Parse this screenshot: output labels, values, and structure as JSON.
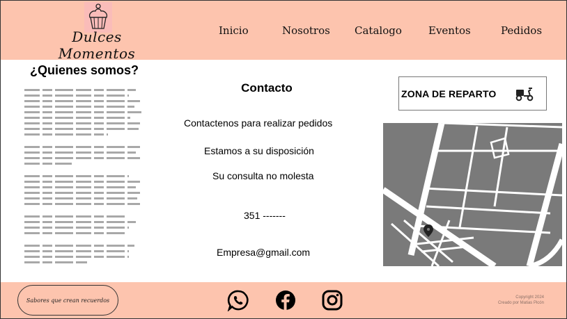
{
  "header": {
    "logo_text": "Dulces Momentos",
    "nav": [
      {
        "label": "Inicio"
      },
      {
        "label": "Nosotros"
      },
      {
        "label": "Catalogo"
      },
      {
        "label": "Eventos"
      },
      {
        "label": "Pedidos"
      }
    ]
  },
  "about": {
    "title": "¿Quienes somos?"
  },
  "contact": {
    "title": "Contacto",
    "line1": "Contactenos para realizar pedidos",
    "line2": "Estamos a su disposición",
    "line3": "Su consulta no molesta",
    "phone": "351 -------",
    "email": "Empresa@gmail.com"
  },
  "delivery": {
    "label": "ZONA DE REPARTO",
    "icon": "scooter-icon"
  },
  "footer": {
    "slogan": "Sabores que crean recuerdos",
    "social_icons": [
      "whatsapp-icon",
      "facebook-icon",
      "instagram-icon"
    ],
    "copyright_line1": "Copyright 2024",
    "copyright_line2": "Creado por Matias Picón"
  },
  "colors": {
    "accent": "#fdc4ae",
    "map": "#7a7a7a",
    "text_placeholder": "#a8a8a8"
  }
}
